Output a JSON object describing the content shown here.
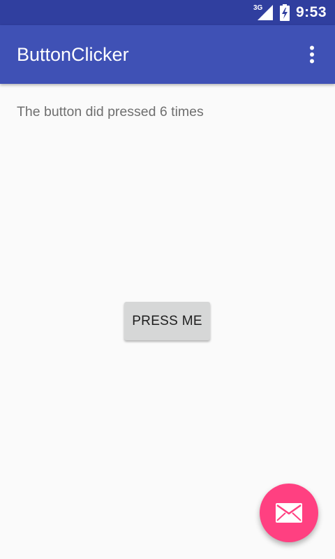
{
  "status_bar": {
    "network_type": "3G",
    "time": "9:53",
    "icons": [
      "signal-icon",
      "battery-charging-icon"
    ]
  },
  "app_bar": {
    "title": "ButtonClicker",
    "menu_icon": "overflow-menu-icon"
  },
  "content": {
    "counter_text": "The button did pressed 6 times",
    "button_label": "PRESS ME"
  },
  "fab": {
    "icon": "email-icon"
  },
  "colors": {
    "status_bar": "#303f9f",
    "primary": "#3f51b5",
    "accent": "#ff4081",
    "background": "#fafafa",
    "button": "#d6d7d7"
  }
}
